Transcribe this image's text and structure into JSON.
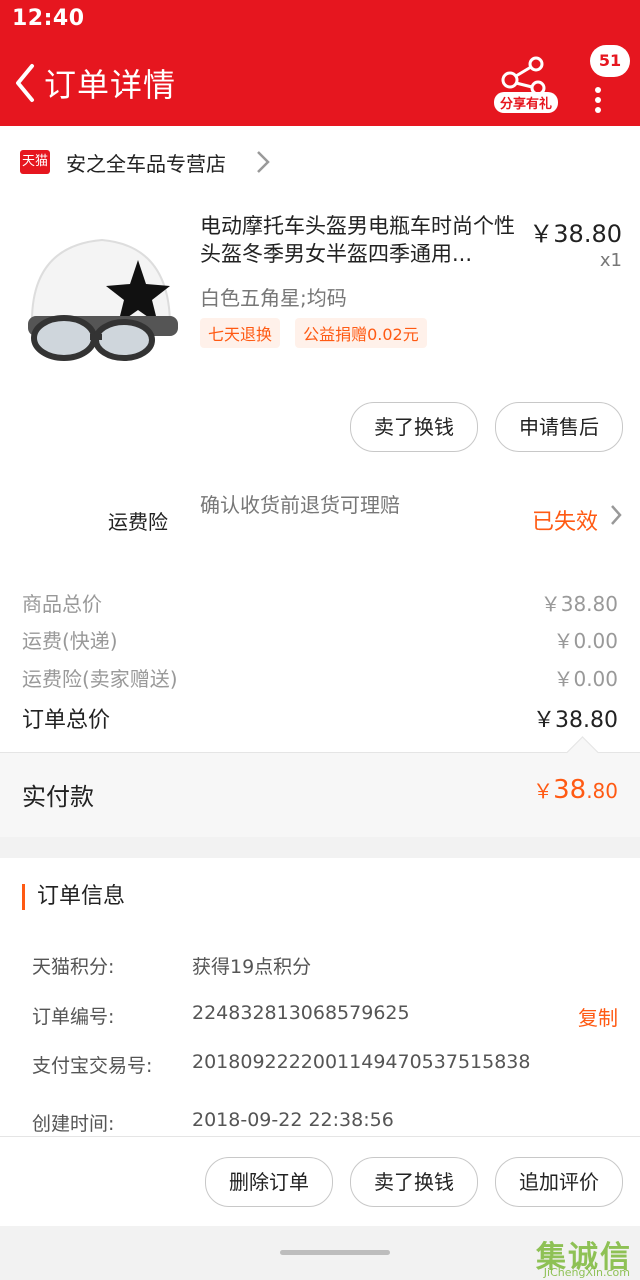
{
  "status": {
    "time": "12:40"
  },
  "header": {
    "title": "订单详情",
    "share_label": "分享有礼",
    "message_count": "51"
  },
  "store": {
    "badge": "天猫",
    "name": "安之全车品专营店"
  },
  "product": {
    "title": "电动摩托车头盔男电瓶车时尚个性头盔冬季男女半盔四季通用...",
    "price": "￥38.80",
    "qty": "x1",
    "variant": "白色五角星;均码",
    "tags": [
      "七天退换",
      "公益捐赠0.02元"
    ],
    "actions": [
      "卖了换钱",
      "申请售后"
    ]
  },
  "insurance": {
    "label": "运费险",
    "desc": "确认收货前退货可理赔",
    "status": "已失效"
  },
  "price_summary": {
    "rows": [
      {
        "label": "商品总价",
        "value": "￥38.80"
      },
      {
        "label": "运费(快递)",
        "value": "￥0.00"
      },
      {
        "label": "运费险(卖家赠送)",
        "value": "￥0.00"
      }
    ],
    "total_label": "订单总价",
    "total_value": "￥38.80"
  },
  "paid": {
    "label": "实付款",
    "currency": "￥",
    "integer": "38",
    "decimal": ".80"
  },
  "order_info": {
    "title": "订单信息",
    "rows": [
      {
        "key": "天猫积分:",
        "value": "获得19点积分"
      },
      {
        "key": "订单编号:",
        "value": "224832813068579625",
        "action": "复制"
      },
      {
        "key": "支付宝交易号:",
        "value": "2018092222001149470537515838"
      },
      {
        "key": "创建时间:",
        "value": "2018-09-22 22:38:56"
      }
    ]
  },
  "bottom_actions": [
    "删除订单",
    "卖了换钱",
    "追加评价"
  ],
  "watermark": {
    "text": "集诚信",
    "sub": "JiChengXin.com"
  },
  "colors": {
    "primary_red": "#e6161f",
    "accent_orange": "#ff5a13"
  }
}
